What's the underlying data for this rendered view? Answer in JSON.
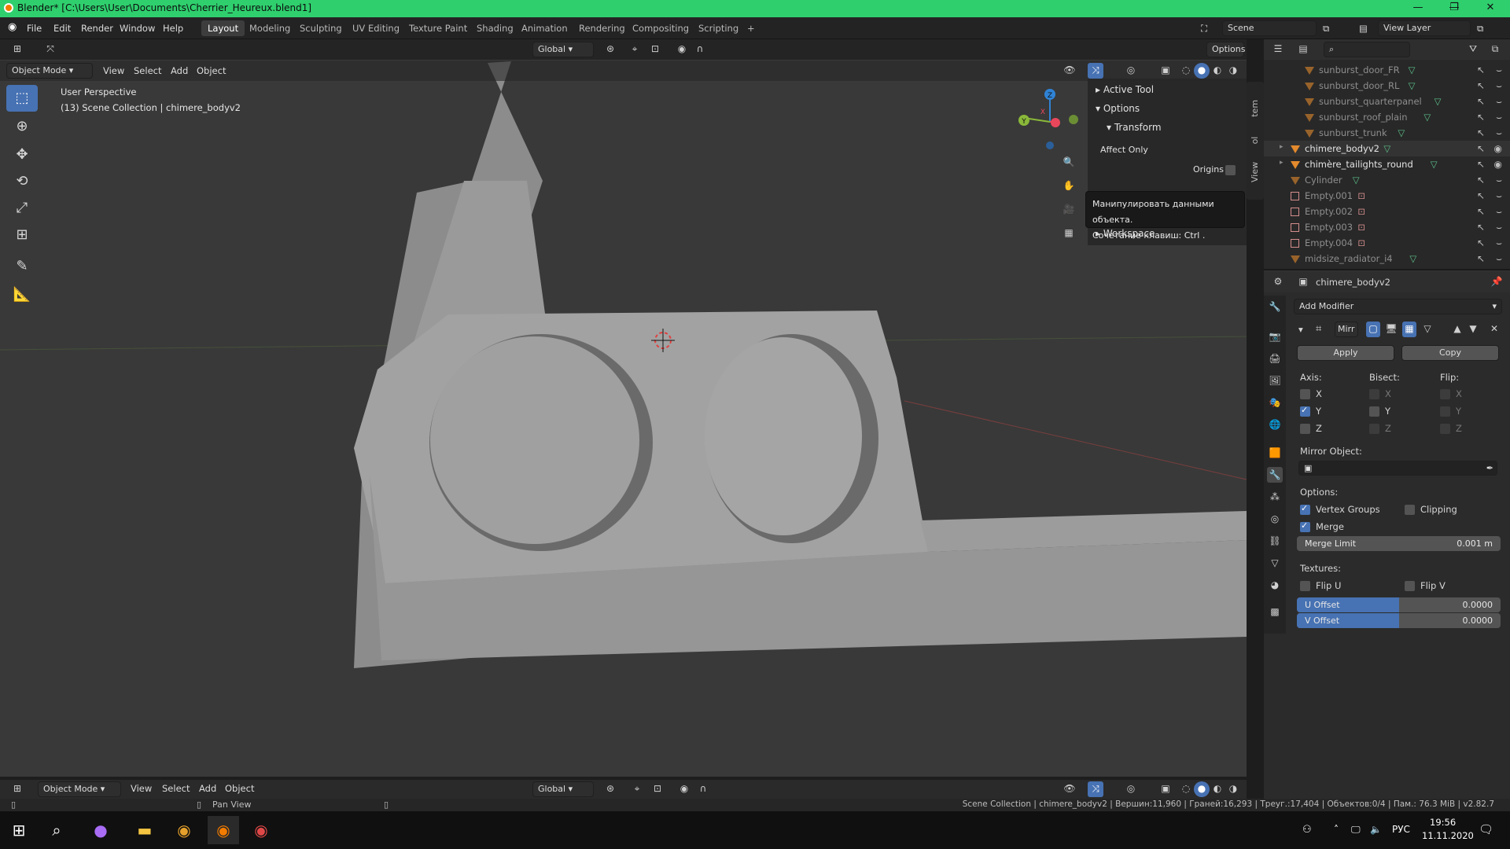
{
  "window": {
    "title": "Blender* [C:\\Users\\User\\Documents\\Cherrier_Heureux.blend1]"
  },
  "menu": {
    "items": [
      "File",
      "Edit",
      "Render",
      "Window",
      "Help"
    ],
    "workspaces": [
      "Layout",
      "Modeling",
      "Sculpting",
      "UV Editing",
      "Texture Paint",
      "Shading",
      "Animation",
      "Rendering",
      "Compositing",
      "Scripting"
    ],
    "active_workspace": "Layout",
    "add_tab": "+",
    "scene": "Scene",
    "view_layer": "View Layer"
  },
  "viewport": {
    "mode": "Object Mode",
    "menus": [
      "View",
      "Select",
      "Add",
      "Object"
    ],
    "orientation": "Global",
    "options": "Options",
    "perspective": "User Perspective",
    "collection_info": "(13) Scene Collection | chimere_bodyv2",
    "gizmo_axes": {
      "x": "X",
      "y": "Y",
      "z": "Z"
    },
    "colors": {
      "x": "#e8475b",
      "y": "#8ab83a",
      "z": "#2f83d6",
      "accent": "#4772b3"
    }
  },
  "npanel": {
    "active_tool": "Active Tool",
    "options": "Options",
    "transform": "Transform",
    "affect_only": "Affect Only",
    "origins": "Origins",
    "workspace": "Workspace",
    "tabs": [
      "Item",
      "Tool",
      "View"
    ]
  },
  "tooltip": {
    "line1": "Манипулировать данными объекта.",
    "line2": "Сочетание клавиш: Ctrl ."
  },
  "outliner": {
    "items": [
      {
        "name": "sunburst_door_FR",
        "type": "mesh-dim"
      },
      {
        "name": "sunburst_door_RL",
        "type": "mesh-dim"
      },
      {
        "name": "sunburst_quarterpanel",
        "type": "mesh-dim"
      },
      {
        "name": "sunburst_roof_plain",
        "type": "mesh-dim"
      },
      {
        "name": "sunburst_trunk",
        "type": "mesh-dim"
      },
      {
        "name": "chimere_bodyv2",
        "type": "mesh-active"
      },
      {
        "name": "chimère_tailights_round",
        "type": "mesh"
      },
      {
        "name": "Cylinder",
        "type": "mesh-dim"
      },
      {
        "name": "Empty.001",
        "type": "empty"
      },
      {
        "name": "Empty.002",
        "type": "empty"
      },
      {
        "name": "Empty.003",
        "type": "empty"
      },
      {
        "name": "Empty.004",
        "type": "empty"
      },
      {
        "name": "midsize_radiator_i4",
        "type": "mesh-dim"
      }
    ]
  },
  "properties": {
    "object_name": "chimere_bodyv2",
    "add_modifier": "Add Modifier",
    "modifier_name": "Mirr",
    "apply": "Apply",
    "copy": "Copy",
    "axis_label": "Axis:",
    "bisect_label": "Bisect:",
    "flip_label": "Flip:",
    "axes": [
      "X",
      "Y",
      "Z"
    ],
    "axis_checked": [
      false,
      true,
      false
    ],
    "mirror_object": "Mirror Object:",
    "options_label": "Options:",
    "vertex_groups": "Vertex Groups",
    "clipping": "Clipping",
    "merge": "Merge",
    "merge_limit_label": "Merge Limit",
    "merge_limit_value": "0.001 m",
    "textures_label": "Textures:",
    "flip_u": "Flip U",
    "flip_v": "Flip V",
    "u_offset_label": "U Offset",
    "u_offset_value": "0.0000",
    "v_offset_label": "V Offset",
    "v_offset_value": "0.0000",
    "offset_fill": 0.5
  },
  "statusbar": {
    "hint": "Pan View",
    "info": "Scene Collection | chimere_bodyv2 | Вершин:11,960 | Граней:16,293 | Треуг.:17,404 | Объектов:0/4 | Пам.: 76.3 MiB | v2.82.7"
  },
  "taskbar": {
    "lang": "РУС",
    "time": "19:56",
    "date": "11.11.2020"
  }
}
